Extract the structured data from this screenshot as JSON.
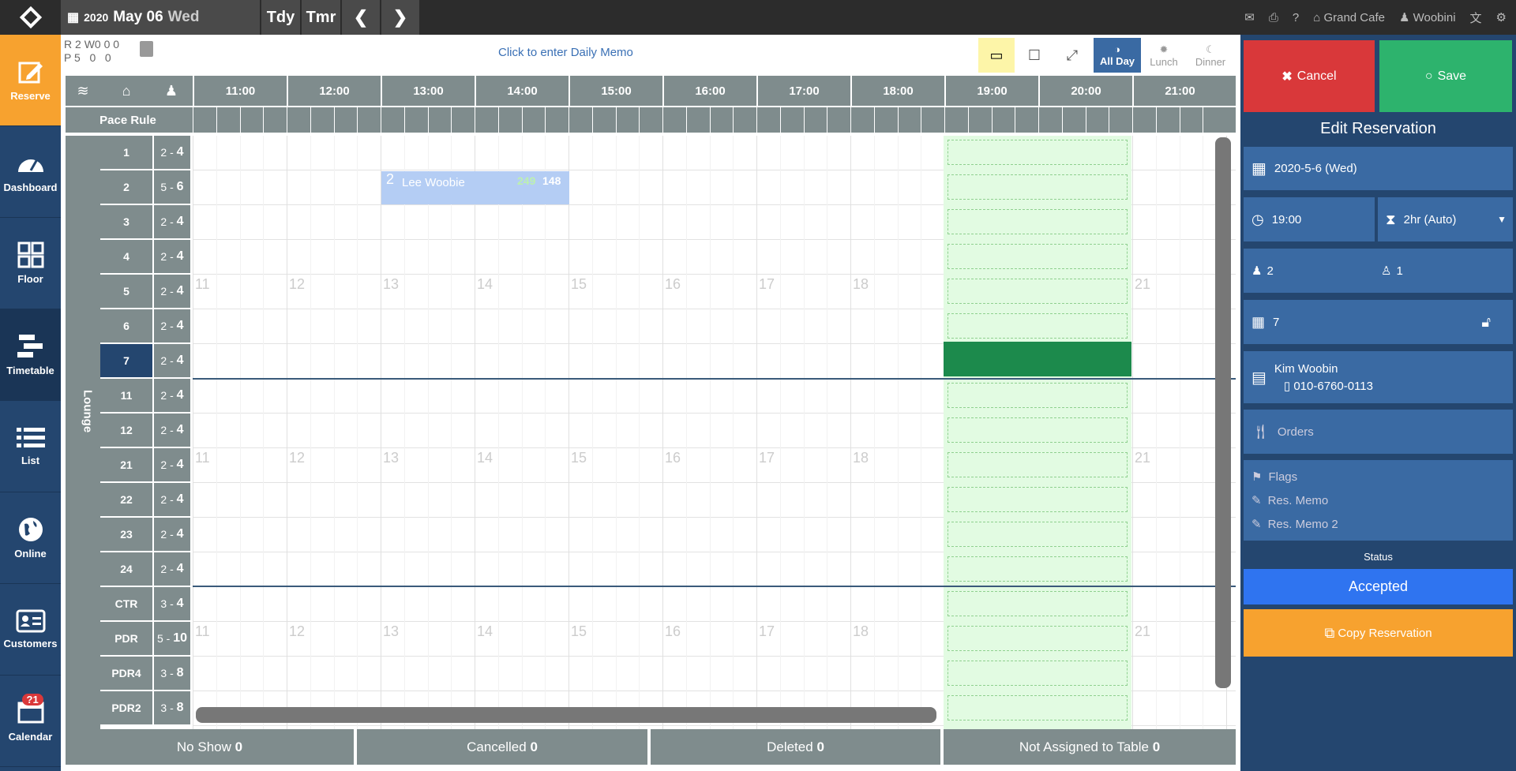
{
  "topbar": {
    "year": "2020",
    "date": "May 06",
    "weekday": "Wed",
    "today_label": "Tdy",
    "tomorrow_label": "Tmr",
    "restaurant": "Grand Cafe",
    "user": "Woobini"
  },
  "sidebar": {
    "items": [
      {
        "label": "Reserve",
        "icon": "edit-icon",
        "active": true
      },
      {
        "label": "Dashboard",
        "icon": "gauge-icon"
      },
      {
        "label": "Floor",
        "icon": "grid-icon"
      },
      {
        "label": "Timetable",
        "icon": "timetable-icon",
        "selected": true
      },
      {
        "label": "List",
        "icon": "list-icon"
      },
      {
        "label": "Online",
        "icon": "globe-icon"
      },
      {
        "label": "Customers",
        "icon": "id-card-icon"
      },
      {
        "label": "Calendar",
        "icon": "calendar-icon",
        "badge": "?1"
      }
    ]
  },
  "stats": {
    "r_label": "R",
    "r_val": "2",
    "w_label": "W",
    "w_val": "0",
    "x_val": "0",
    "x2_val": "0",
    "p_label": "P",
    "p_val": "5",
    "p2_val": "0",
    "p3_val": "0"
  },
  "memo_placeholder": "Click to enter Daily Memo",
  "shifts": {
    "all_day": "All Day",
    "lunch": "Lunch",
    "dinner": "Dinner"
  },
  "timeline": {
    "hours": [
      "11:00",
      "12:00",
      "13:00",
      "14:00",
      "15:00",
      "16:00",
      "17:00",
      "18:00",
      "19:00",
      "20:00",
      "21:00"
    ],
    "pace_rule": "Pace Rule",
    "section": "Lounge",
    "hour_marks": [
      "11",
      "12",
      "13",
      "14",
      "15",
      "16",
      "17",
      "18",
      "21"
    ]
  },
  "tables": [
    {
      "name": "1",
      "min": "2",
      "max": "4"
    },
    {
      "name": "2",
      "min": "5",
      "max": "6"
    },
    {
      "name": "3",
      "min": "2",
      "max": "4"
    },
    {
      "name": "4",
      "min": "2",
      "max": "4"
    },
    {
      "name": "5",
      "min": "2",
      "max": "4"
    },
    {
      "name": "6",
      "min": "2",
      "max": "4"
    },
    {
      "name": "7",
      "min": "2",
      "max": "4"
    },
    {
      "name": "11",
      "min": "2",
      "max": "4"
    },
    {
      "name": "12",
      "min": "2",
      "max": "4"
    },
    {
      "name": "21",
      "min": "2",
      "max": "4"
    },
    {
      "name": "22",
      "min": "2",
      "max": "4"
    },
    {
      "name": "23",
      "min": "2",
      "max": "4"
    },
    {
      "name": "24",
      "min": "2",
      "max": "4"
    },
    {
      "name": "CTR",
      "min": "3",
      "max": "4"
    },
    {
      "name": "PDR",
      "min": "5",
      "max": "10"
    },
    {
      "name": "PDR4",
      "min": "3",
      "max": "8"
    },
    {
      "name": "PDR2",
      "min": "3",
      "max": "8"
    }
  ],
  "reservation": {
    "party": "2",
    "name": "Lee Woobie",
    "a": "249",
    "b": "148"
  },
  "footer": {
    "no_show": "No Show",
    "no_show_count": "0",
    "cancelled": "Cancelled",
    "cancelled_count": "0",
    "deleted": "Deleted",
    "deleted_count": "0",
    "unassigned": "Not Assigned to Table",
    "unassigned_count": "0"
  },
  "panel": {
    "cancel": "Cancel",
    "save": "Save",
    "title": "Edit Reservation",
    "date": "2020-5-6 (Wed)",
    "time": "19:00",
    "duration": "2hr (Auto)",
    "adults": "2",
    "kids": "1",
    "table": "7",
    "customer_name": "Kim Woobin",
    "phone": "010-6760-0113",
    "orders": "Orders",
    "flags": "Flags",
    "memo": "Res. Memo",
    "memo2": "Res. Memo 2",
    "status_label": "Status",
    "status": "Accepted",
    "copy": "Copy Reservation"
  },
  "colors": {
    "accent": "#f7a22f",
    "cancel": "#d9383a",
    "save": "#2db36d",
    "panel": "#24466f",
    "status": "#2f74f0"
  }
}
